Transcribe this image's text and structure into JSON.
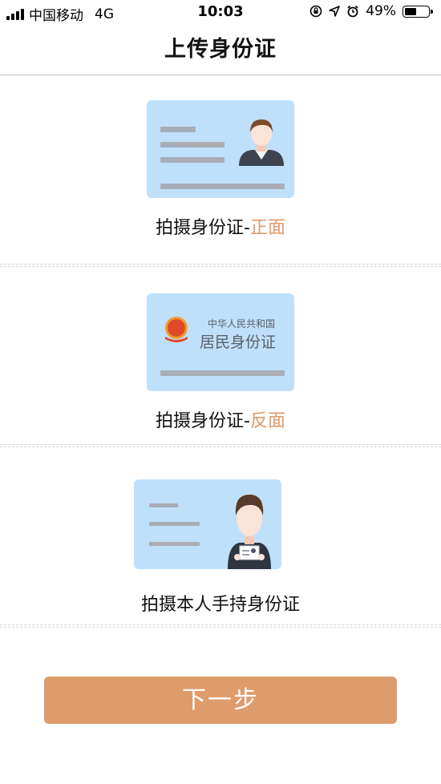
{
  "status_bar": {
    "carrier": "中国移动",
    "network": "4G",
    "time": "10:03",
    "battery": "49%",
    "icons": [
      "signal-icon",
      "rotation-lock-icon",
      "location-icon",
      "alarm-icon",
      "battery-icon"
    ]
  },
  "header": {
    "title": "上传身份证"
  },
  "uploads": [
    {
      "label_prefix": "拍摄身份证-",
      "label_accent": "正面"
    },
    {
      "label_prefix": "拍摄身份证-",
      "label_accent": "反面",
      "card_title_small": "中华人民共和国",
      "card_title_big": "居民身份证"
    },
    {
      "label": "拍摄本人手持身份证"
    }
  ],
  "footer": {
    "next_label": "下一步"
  },
  "colors": {
    "accent": "#df9a6b",
    "button": "#de9b6c",
    "card": "#bfe0fb"
  }
}
